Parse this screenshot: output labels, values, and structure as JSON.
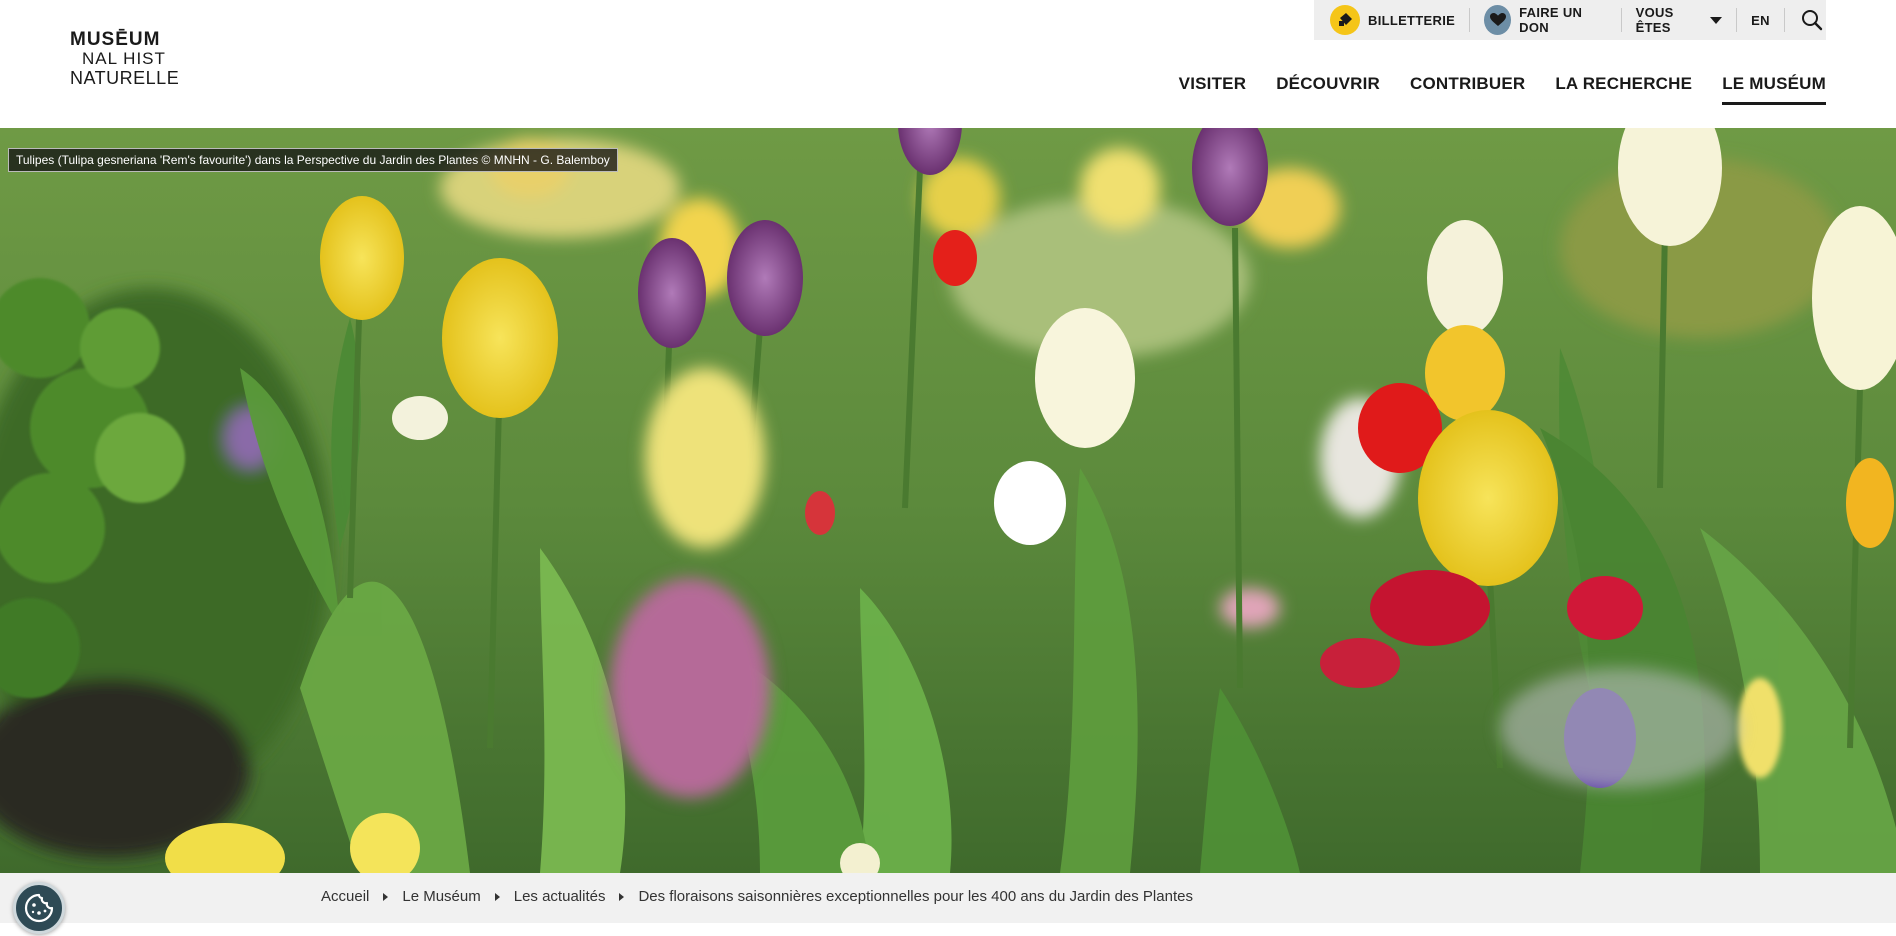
{
  "logo": {
    "line1": "MUSĒUM",
    "line2": "NAL HIST",
    "line3": "NATURELLE"
  },
  "utility": {
    "ticketing": "BILLETTERIE",
    "donate": "FAIRE UN DON",
    "audience": "VOUS ÊTES",
    "language": "EN"
  },
  "nav": {
    "items": [
      "VISITER",
      "DÉCOUVRIR",
      "CONTRIBUER",
      "LA RECHERCHE",
      "LE MUSÉUM"
    ],
    "active": "LE MUSÉUM"
  },
  "hero": {
    "caption": "Tulipes (Tulipa gesneriana 'Rem's favourite') dans la Perspective du Jardin des Plantes © MNHN - G. Balemboy"
  },
  "breadcrumb": {
    "items": [
      "Accueil",
      "Le Muséum",
      "Les actualités",
      "Des floraisons saisonnières exceptionnelles pour les 400 ans du Jardin des Plantes"
    ]
  },
  "colors": {
    "ticket_icon_bg": "#f5c518",
    "donate_icon_bg": "#6d8ea6",
    "utility_bar_bg": "#eeeeee",
    "breadcrumb_bg": "#f1f1f1",
    "cookie_bg": "#2e4a55"
  },
  "icons": {
    "ticket": "ticket-icon",
    "donate": "heart-icon",
    "audience": "chevron-down-icon",
    "search": "search-icon",
    "cookie": "cookie-icon",
    "breadcrumb_sep": "chevron-right-icon"
  }
}
